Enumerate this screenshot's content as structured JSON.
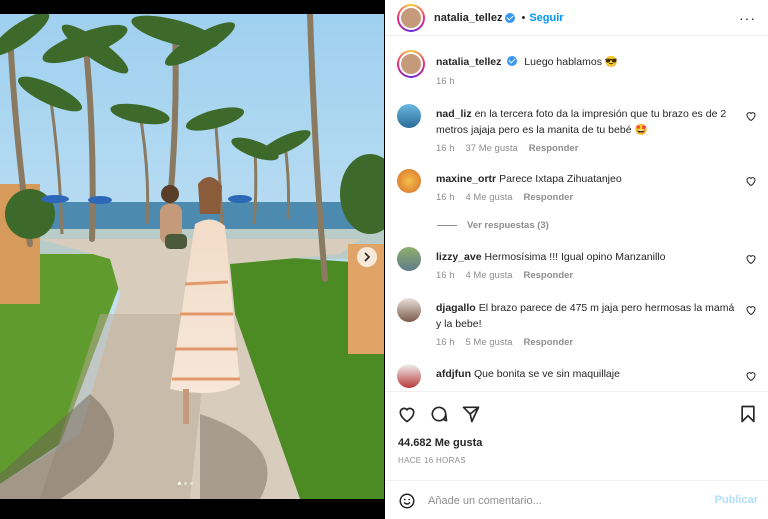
{
  "post": {
    "username": "natalia_tellez",
    "follow_label": "Seguir",
    "separator": "•",
    "caption": "Luego hablamos 😎",
    "caption_time": "16 h",
    "likes": "44.682 Me gusta",
    "timestamp": "HACE 16 HORAS",
    "more_label": "···"
  },
  "comments": [
    {
      "user": "nad_liz",
      "text": "en la tercera foto da la impresión que tu brazo es de 2 metros jajaja pero es la manita de tu bebé 🤩",
      "time": "16 h",
      "likes": "37 Me gusta",
      "reply": "Responder"
    },
    {
      "user": "maxine_ortr",
      "text": "Parece Ixtapa Zihuatanjeo",
      "time": "16 h",
      "likes": "4 Me gusta",
      "reply": "Responder"
    },
    {
      "user": "lizzy_ave",
      "text": "Hermosísima !!! Igual opino Manzanillo",
      "time": "16 h",
      "likes": "4 Me gusta",
      "reply": "Responder"
    },
    {
      "user": "djagallo",
      "text": "El brazo parece de 475 m jaja pero hermosas la mamá y la bebe!",
      "time": "16 h",
      "likes": "5 Me gusta",
      "reply": "Responder"
    },
    {
      "user": "afdjfun",
      "text": "Que bonita se ve sin maquillaje",
      "time": "",
      "likes": "",
      "reply": ""
    }
  ],
  "view_replies": "Ver respuestas (3)",
  "add_comment": {
    "placeholder": "Añade un comentario...",
    "publish": "Publicar"
  },
  "icons": {
    "like": "heart-icon",
    "comment": "comment-icon",
    "share": "share-icon",
    "save": "bookmark-icon",
    "emoji": "emoji-icon",
    "next": "chevron-right-icon",
    "more": "more-options-icon",
    "verified": "verified-badge-icon"
  },
  "colors": {
    "accent": "#0095f6",
    "verified": "#3897f0",
    "muted": "#8e8e8e"
  },
  "carousel": {
    "total": 3,
    "active": 1
  }
}
